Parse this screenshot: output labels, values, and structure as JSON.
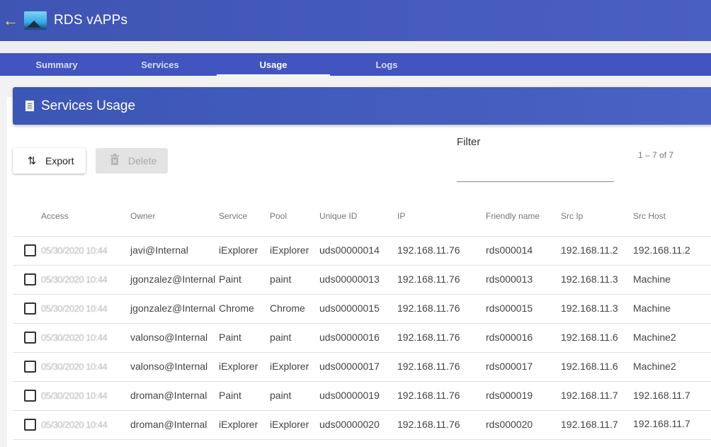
{
  "header": {
    "title": "RDS vAPPs",
    "back_icon": "arrow-left-icon",
    "logo_icon": "landscape-logo-icon"
  },
  "tabs": [
    {
      "label": "Summary",
      "active": false
    },
    {
      "label": "Services",
      "active": false
    },
    {
      "label": "Usage",
      "active": true
    },
    {
      "label": "Logs",
      "active": false
    }
  ],
  "panel": {
    "title": "Services Usage",
    "icon": "document-icon"
  },
  "toolbar": {
    "export_label": "Export",
    "export_icon": "swap-vertical-icon",
    "delete_label": "Delete",
    "delete_icon": "trash-icon"
  },
  "filter": {
    "label": "Filter",
    "value": ""
  },
  "pagination": {
    "range": "1 – 7 of 7"
  },
  "table": {
    "columns": [
      "Access",
      "Owner",
      "Service",
      "Pool",
      "Unique ID",
      "IP",
      "Friendly name",
      "Src Ip",
      "Src Host"
    ],
    "rows": [
      {
        "access": "05/30/2020 10:44",
        "owner": "javi@Internal",
        "service": "iExplorer",
        "pool": "iExplorer",
        "unique_id": "uds00000014",
        "ip": "192.168.11.76",
        "friendly": "rds000014",
        "src_ip": "192.168.11.2",
        "src_host": "192.168.11.2"
      },
      {
        "access": "05/30/2020 10:44",
        "owner": "jgonzalez@Internal",
        "service": "Paint",
        "pool": "paint",
        "unique_id": "uds00000013",
        "ip": "192.168.11.76",
        "friendly": "rds000013",
        "src_ip": "192.168.11.3",
        "src_host": "Machine"
      },
      {
        "access": "05/30/2020 10:44",
        "owner": "jgonzalez@Internal",
        "service": "Chrome",
        "pool": "Chrome",
        "unique_id": "uds00000015",
        "ip": "192.168.11.76",
        "friendly": "rds000015",
        "src_ip": "192.168.11.3",
        "src_host": "Machine"
      },
      {
        "access": "05/30/2020 10:44",
        "owner": "valonso@Internal",
        "service": "Paint",
        "pool": "paint",
        "unique_id": "uds00000016",
        "ip": "192.168.11.76",
        "friendly": "rds000016",
        "src_ip": "192.168.11.6",
        "src_host": "Machine2"
      },
      {
        "access": "05/30/2020 10:44",
        "owner": "valonso@Internal",
        "service": "iExplorer",
        "pool": "iExplorer",
        "unique_id": "uds00000017",
        "ip": "192.168.11.76",
        "friendly": "rds000017",
        "src_ip": "192.168.11.6",
        "src_host": "Machine2"
      },
      {
        "access": "05/30/2020 10:44",
        "owner": "droman@Internal",
        "service": "Paint",
        "pool": "paint",
        "unique_id": "uds00000019",
        "ip": "192.168.11.76",
        "friendly": "rds000019",
        "src_ip": "192.168.11.7",
        "src_host": "192.168.11.7"
      },
      {
        "access": "05/30/2020 10:44",
        "owner": "droman@Internal",
        "service": "iExplorer",
        "pool": "iExplorer",
        "unique_id": "uds00000020",
        "ip": "192.168.11.76",
        "friendly": "rds000020",
        "src_ip": "192.168.11.7",
        "src_host": "192.168.11.7"
      }
    ]
  }
}
